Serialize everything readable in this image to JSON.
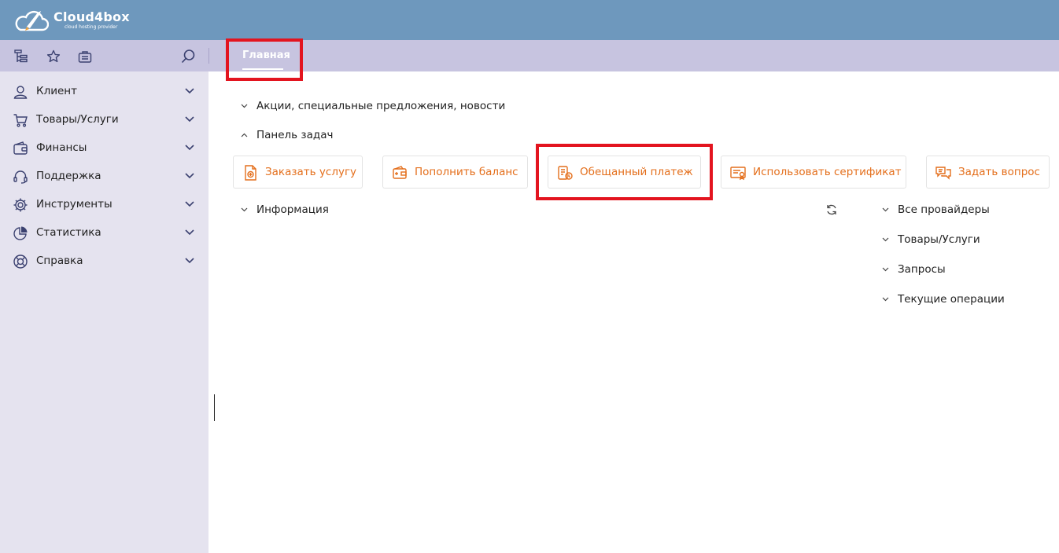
{
  "brand": {
    "title": "Cloud4box",
    "subtitle": "cloud hosting provider"
  },
  "toolbar": {
    "icons": [
      "tree-icon",
      "star-icon",
      "briefcase-icon",
      "search-icon"
    ],
    "tab_main": "Главная"
  },
  "sidebar": {
    "items": [
      {
        "label": "Клиент",
        "icon": "user-icon"
      },
      {
        "label": "Товары/Услуги",
        "icon": "cart-icon"
      },
      {
        "label": "Финансы",
        "icon": "wallet-icon"
      },
      {
        "label": "Поддержка",
        "icon": "headset-icon"
      },
      {
        "label": "Инструменты",
        "icon": "gear-icon"
      },
      {
        "label": "Статистика",
        "icon": "pie-chart-icon"
      },
      {
        "label": "Справка",
        "icon": "lifebuoy-icon"
      }
    ]
  },
  "main": {
    "section_news": "Акции, специальные предложения, новости",
    "section_tasks": "Панель задач",
    "actions": [
      {
        "label": "Заказать услугу",
        "icon": "order-doc-icon"
      },
      {
        "label": "Пополнить баланс",
        "icon": "wallet-add-icon"
      },
      {
        "label": "Обещанный платеж",
        "icon": "promised-payment-icon"
      },
      {
        "label": "Использовать сертификат",
        "icon": "certificate-icon"
      },
      {
        "label": "Задать вопрос",
        "icon": "chat-icon"
      }
    ],
    "section_info": "Информация",
    "info_panels": [
      "Все провайдеры",
      "Товары/Услуги",
      "Запросы",
      "Текущие операции"
    ]
  },
  "colors": {
    "topbar": "#6e98bd",
    "toolbar": "#c7c4e0",
    "sidebar": "#e5e3ef",
    "accent": "#e46f1c",
    "highlight": "#e3141f"
  }
}
